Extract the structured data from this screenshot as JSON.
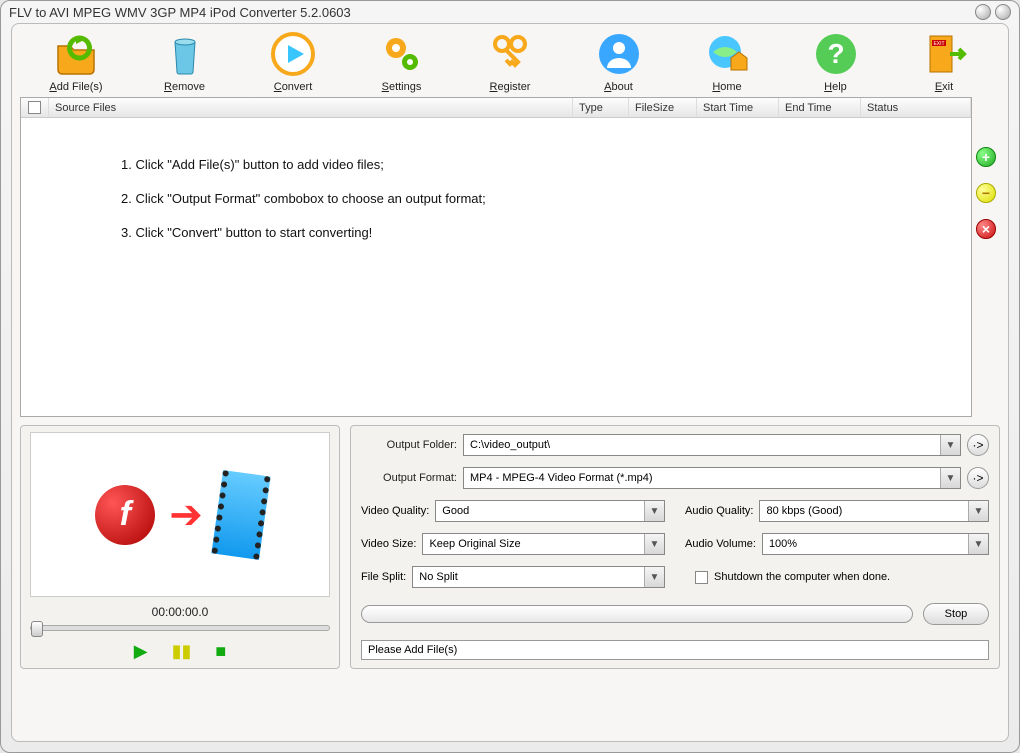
{
  "title": "FLV to AVI MPEG WMV 3GP MP4 iPod Converter 5.2.0603",
  "toolbar": [
    {
      "label": "Add File(s)",
      "u": "A",
      "rest": "dd File(s)"
    },
    {
      "label": "Remove",
      "u": "R",
      "rest": "emove"
    },
    {
      "label": "Convert",
      "u": "C",
      "rest": "onvert"
    },
    {
      "label": "Settings",
      "u": "S",
      "rest": "ettings"
    },
    {
      "label": "Register",
      "u": "R",
      "rest": "egister"
    },
    {
      "label": "About",
      "u": "A",
      "rest": "bout"
    },
    {
      "label": "Home",
      "u": "H",
      "rest": "ome"
    },
    {
      "label": "Help",
      "u": "H",
      "rest": "elp"
    },
    {
      "label": "Exit",
      "u": "E",
      "rest": "xit"
    }
  ],
  "columns": {
    "source": "Source Files",
    "type": "Type",
    "size": "FileSize",
    "start": "Start Time",
    "end": "End Time",
    "status": "Status"
  },
  "instructions": [
    "1. Click \"Add File(s)\" button to add video files;",
    "2. Click \"Output Format\" combobox to choose an output format;",
    "3. Click \"Convert\" button to start converting!"
  ],
  "preview": {
    "time": "00:00:00.0"
  },
  "settings": {
    "output_folder_label": "Output Folder:",
    "output_folder": "C:\\video_output\\",
    "output_format_label": "Output Format:",
    "output_format": "MP4 - MPEG-4 Video Format (*.mp4)",
    "video_quality_label": "Video Quality:",
    "video_quality": "Good",
    "audio_quality_label": "Audio Quality:",
    "audio_quality": "80  kbps (Good)",
    "video_size_label": "Video Size:",
    "video_size": "Keep Original Size",
    "audio_volume_label": "Audio Volume:",
    "audio_volume": "100%",
    "file_split_label": "File Split:",
    "file_split": "No Split",
    "shutdown_label": "Shutdown the computer when done."
  },
  "stop_label": "Stop",
  "status_text": "Please Add File(s)"
}
